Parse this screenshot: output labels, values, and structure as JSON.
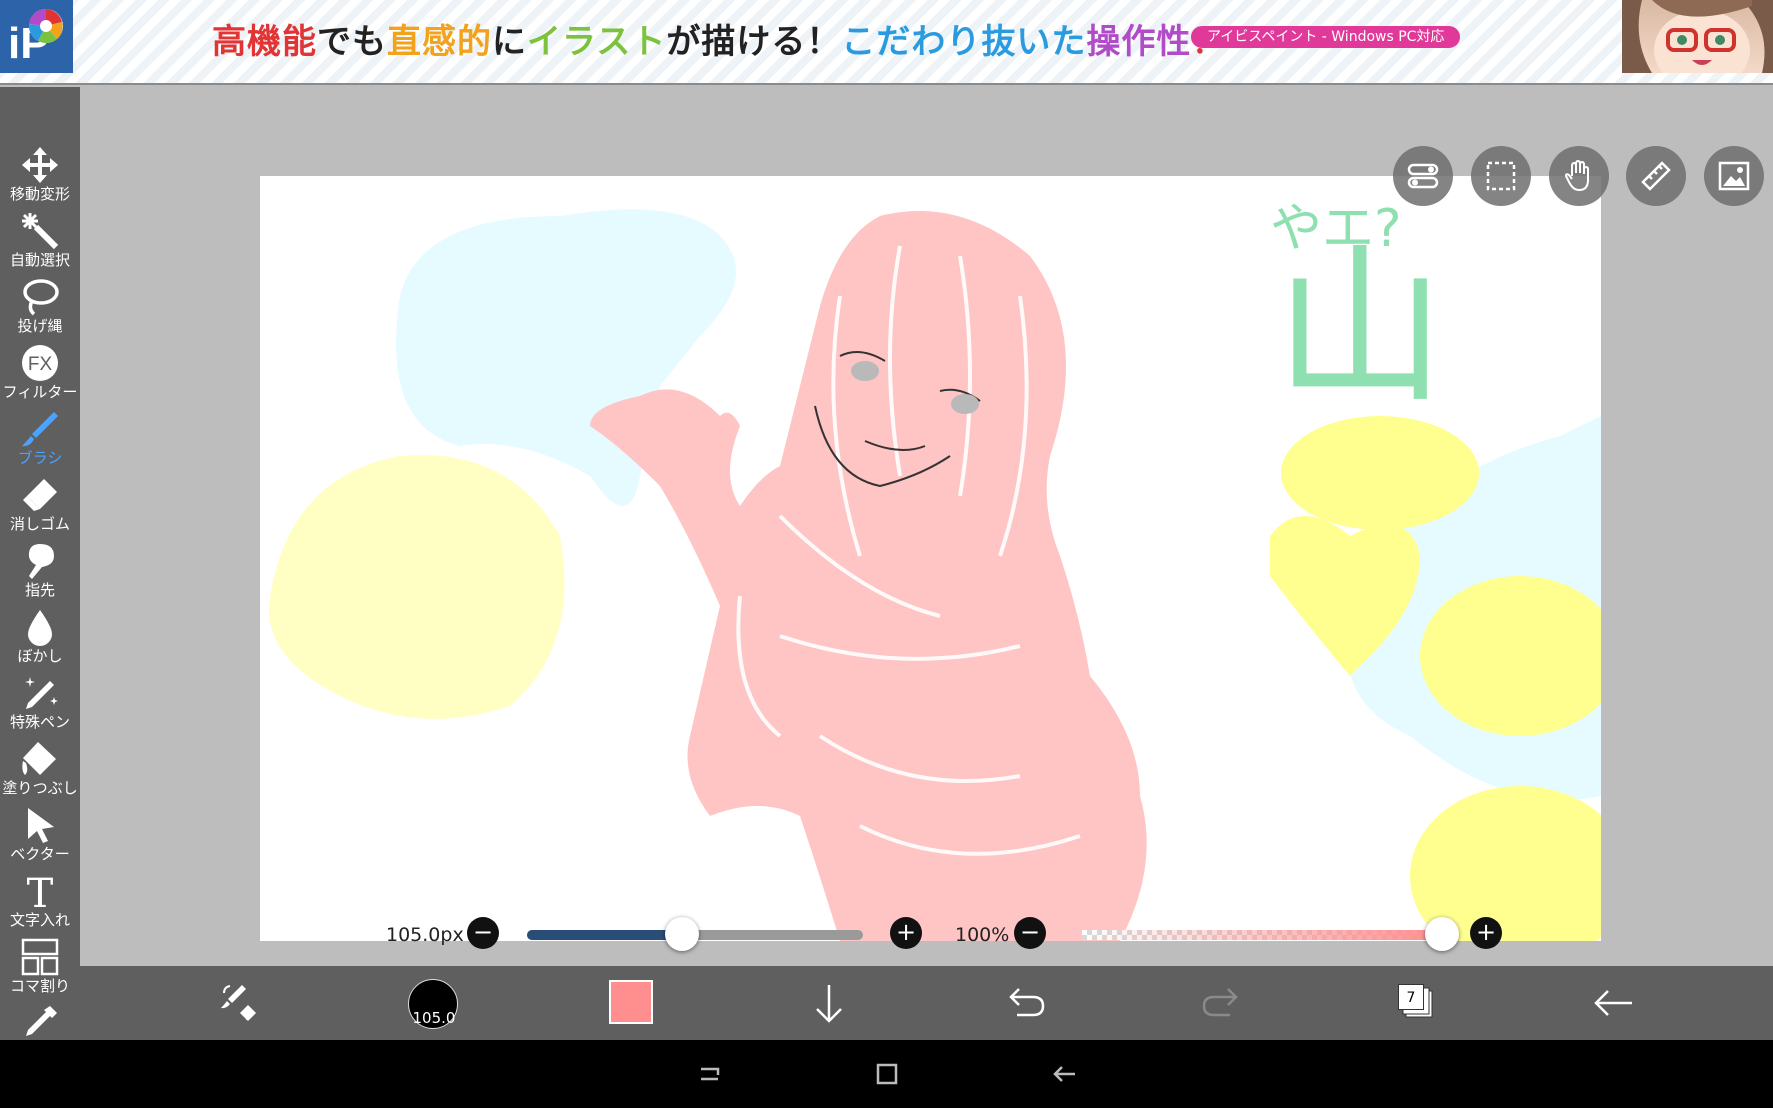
{
  "ad": {
    "headline": [
      {
        "text": "高機能",
        "color": "#e23434"
      },
      {
        "text": "でも",
        "color": "#222222"
      },
      {
        "text": "直感的",
        "color": "#f2a21b"
      },
      {
        "text": "に",
        "color": "#222222"
      },
      {
        "text": "イラスト",
        "color": "#7cc23f"
      },
      {
        "text": "が描ける！",
        "color": "#222222"
      },
      {
        "text": "こだわり抜いた",
        "color": "#2b9be0"
      },
      {
        "text": "操作性",
        "color": "#b24bc8"
      },
      {
        "text": "！",
        "color": "#e23434"
      }
    ],
    "badge": "アイビスペイント - Windows PC対応",
    "logo_text": "iP"
  },
  "tools": [
    {
      "label": "移動変形",
      "icon": "move-icon"
    },
    {
      "label": "自動選択",
      "icon": "magic-wand-icon"
    },
    {
      "label": "投げ縄",
      "icon": "lasso-icon"
    },
    {
      "label": "フィルター",
      "icon": "fx-icon"
    },
    {
      "label": "ブラシ",
      "icon": "brush-icon",
      "active": true
    },
    {
      "label": "消しゴム",
      "icon": "eraser-icon"
    },
    {
      "label": "指先",
      "icon": "smudge-icon"
    },
    {
      "label": "ぼかし",
      "icon": "blur-drop-icon"
    },
    {
      "label": "特殊ペン",
      "icon": "special-pen-icon"
    },
    {
      "label": "塗りつぶし",
      "icon": "fill-bucket-icon"
    },
    {
      "label": "ベクター",
      "icon": "vector-cursor-icon"
    },
    {
      "label": "文字入れ",
      "icon": "text-icon"
    },
    {
      "label": "コマ割り",
      "icon": "frame-divider-icon"
    }
  ],
  "floating_buttons": [
    "toggle-icon",
    "selection-rect-icon",
    "hand-icon",
    "ruler-icon",
    "image-icon"
  ],
  "canvas": {
    "doodle_text_1": "やエ?",
    "doodle_text_2": "山"
  },
  "brush_size": {
    "label": "105.0px",
    "value_fraction": 0.46,
    "minus": "−",
    "plus": "+"
  },
  "opacity": {
    "label": "100%",
    "value_fraction": 1.0,
    "minus": "−",
    "plus": "+"
  },
  "bottom": {
    "brush_size_display": "105.0",
    "color_hex": "#ff8f8f",
    "layer_count": "7"
  }
}
